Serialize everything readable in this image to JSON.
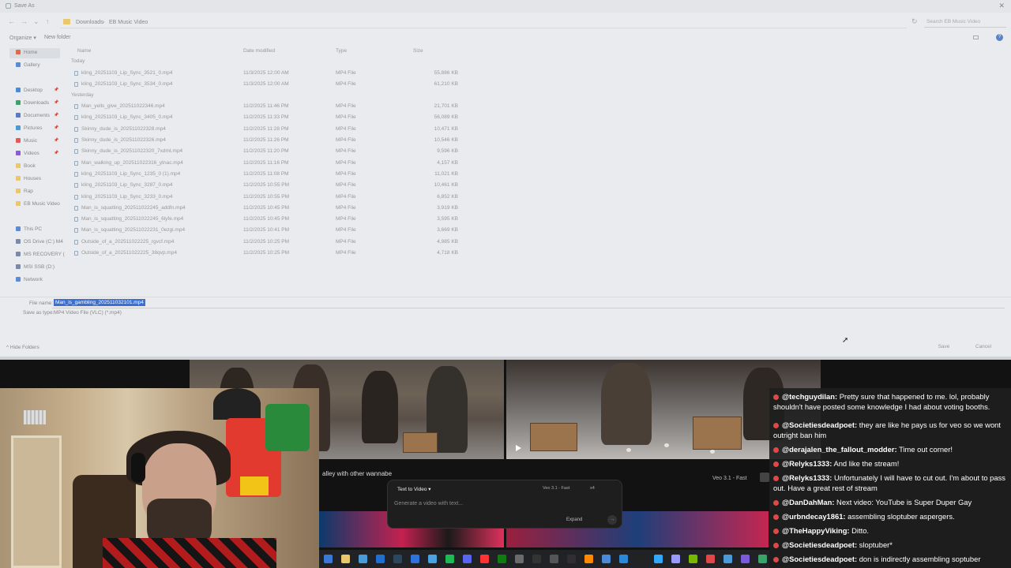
{
  "dialog": {
    "title": "Save As",
    "breadcrumbs": [
      "Downloads",
      "›",
      "EB Music Video"
    ],
    "search_placeholder": "Search EB Music Video",
    "organize_label": "Organize ▾",
    "new_folder_label": "New folder",
    "sidebar": [
      {
        "label": "Home",
        "icon": "home-icon",
        "color": "#e06a4a"
      },
      {
        "label": "Gallery",
        "icon": "gallery-icon",
        "color": "#5a8ad8"
      },
      {
        "label": "Desktop",
        "icon": "desktop-icon",
        "color": "#4a8ad8"
      },
      {
        "label": "Downloads",
        "icon": "downloads-icon",
        "color": "#3aa36a"
      },
      {
        "label": "Documents",
        "icon": "documents-icon",
        "color": "#5a7ac8"
      },
      {
        "label": "Pictures",
        "icon": "pictures-icon",
        "color": "#4a9ad8"
      },
      {
        "label": "Music",
        "icon": "music-icon",
        "color": "#e05a5a"
      },
      {
        "label": "Videos",
        "icon": "videos-icon",
        "color": "#8a5ad8"
      },
      {
        "label": "Book",
        "icon": "folder-icon",
        "color": "#e8c86a"
      },
      {
        "label": "Houses",
        "icon": "folder-icon",
        "color": "#e8c86a"
      },
      {
        "label": "Rap",
        "icon": "folder-icon",
        "color": "#e8c86a"
      },
      {
        "label": "EB Music Video",
        "icon": "folder-icon",
        "color": "#e8c86a"
      },
      {
        "label": "This PC",
        "icon": "pc-icon",
        "color": "#5a8ad8"
      },
      {
        "label": "OS Drive (C:) M4",
        "icon": "drive-icon",
        "color": "#7a8aa8"
      },
      {
        "label": "MS RECOVERY (",
        "icon": "drive-icon",
        "color": "#7a8aa8"
      },
      {
        "label": "MSI SSB (D:)",
        "icon": "drive-icon",
        "color": "#7a8aa8"
      },
      {
        "label": "Network",
        "icon": "network-icon",
        "color": "#5a8ad8"
      }
    ],
    "columns": {
      "name": "Name",
      "date": "Date modified",
      "type": "Type",
      "size": "Size"
    },
    "groups": [
      {
        "label": "Today",
        "files": [
          {
            "name": "kling_20251103_Lip_Sync_3521_0.mp4",
            "date": "11/3/2025 12:00 AM",
            "type": "MP4 File",
            "size": "55,886 KB"
          },
          {
            "name": "kling_20251103_Lip_Sync_3534_0.mp4",
            "date": "11/3/2025 12:00 AM",
            "type": "MP4 File",
            "size": "61,210 KB"
          }
        ]
      },
      {
        "label": "Yesterday",
        "files": [
          {
            "name": "Man_yells_give_202511022346.mp4",
            "date": "11/2/2025 11:46 PM",
            "type": "MP4 File",
            "size": "21,701 KB"
          },
          {
            "name": "kling_20251103_Lip_Sync_3405_0.mp4",
            "date": "11/2/2025 11:33 PM",
            "type": "MP4 File",
            "size": "56,089 KB"
          },
          {
            "name": "Skinny_dude_is_202511022328.mp4",
            "date": "11/2/2025 11:28 PM",
            "type": "MP4 File",
            "size": "10,471 KB"
          },
          {
            "name": "Skinny_dude_is_202511022326.mp4",
            "date": "11/2/2025 11:26 PM",
            "type": "MP4 File",
            "size": "10,546 KB"
          },
          {
            "name": "Skinny_dude_is_202511022320_7xdmt.mp4",
            "date": "11/2/2025 11:20 PM",
            "type": "MP4 File",
            "size": "9,596 KB"
          },
          {
            "name": "Man_walking_up_202511022316_ytnac.mp4",
            "date": "11/2/2025 11:16 PM",
            "type": "MP4 File",
            "size": "4,157 KB"
          },
          {
            "name": "kling_20251103_Lip_Sync_1235_0 (1).mp4",
            "date": "11/2/2025 11:08 PM",
            "type": "MP4 File",
            "size": "11,021 KB"
          },
          {
            "name": "kling_20251103_Lip_Sync_3287_0.mp4",
            "date": "11/2/2025 10:55 PM",
            "type": "MP4 File",
            "size": "10,461 KB"
          },
          {
            "name": "kling_20251103_Lip_Sync_3233_0.mp4",
            "date": "11/2/2025 10:55 PM",
            "type": "MP4 File",
            "size": "6,852 KB"
          },
          {
            "name": "Man_is_squatting_202511022245_addfn.mp4",
            "date": "11/2/2025 10:45 PM",
            "type": "MP4 File",
            "size": "3,919 KB"
          },
          {
            "name": "Man_is_squatting_202511022245_6lyfe.mp4",
            "date": "11/2/2025 10:45 PM",
            "type": "MP4 File",
            "size": "3,595 KB"
          },
          {
            "name": "Man_is_squatting_202511022231_0ezgi.mp4",
            "date": "11/2/2025 10:41 PM",
            "type": "MP4 File",
            "size": "3,669 KB"
          },
          {
            "name": "Outside_of_a_202511022225_rgvcf.mp4",
            "date": "11/2/2025 10:25 PM",
            "type": "MP4 File",
            "size": "4,985 KB"
          },
          {
            "name": "Outside_of_a_202511022225_38qvp.mp4",
            "date": "11/2/2025 10:25 PM",
            "type": "MP4 File",
            "size": "4,718 KB"
          }
        ]
      }
    ],
    "file_name_label": "File name:",
    "file_name_value": "Man_is_gambling_202511032101.mp4",
    "save_type_label": "Save as type:",
    "save_type_value": "MP4 Video File (VLC) (*.mp4)",
    "hide_folders_label": "^ Hide Folders",
    "save_label": "Save",
    "cancel_label": "Cancel"
  },
  "app": {
    "prompt_fragment": "alley with other wannabe",
    "model_tag": "Veo 3.1 - Fast",
    "composer": {
      "mode_label": "Text to Video ▾",
      "model_label": "Veo 3.1 - Fast",
      "options_label": "x4",
      "placeholder": "Generate a video with text...",
      "expand_label": "Expand",
      "send_glyph": "→"
    }
  },
  "taskbar_icons": [
    "edge-icon",
    "folder-icon",
    "chrome-icon",
    "store-icon",
    "steam-icon",
    "mail-icon",
    "photos-icon",
    "spotify-icon",
    "discord-icon",
    "youtube-icon",
    "xbox-icon",
    "settings-icon",
    "terminal-icon",
    "calculator-icon",
    "obs-icon",
    "vlc-icon",
    "notepad-icon",
    "paint-icon",
    "capcut-icon",
    "photoshop-icon",
    "premiere-icon",
    "nvidia-icon",
    "game-icon",
    "app-icon",
    "app2-icon",
    "app3-icon"
  ],
  "chat": [
    {
      "user": "@techguydilan:",
      "text": " Pretty sure that happened to me. lol, probably shouldn't have posted some knowledge I had about voting booths."
    },
    {
      "user": "@Societiesdeadpoet:",
      "text": " they are like he pays us for veo so we wont outright ban him"
    },
    {
      "user": "@derajalen_the_fallout_modder:",
      "text": " Time out corner!"
    },
    {
      "user": "@Relyks1333:",
      "text": " And like the stream!"
    },
    {
      "user": "@Relyks1333:",
      "text": " Unfortunately I will have to cut out. I'm about to pass out. Have a great rest of stream"
    },
    {
      "user": "@DanDahMan:",
      "text": " Next video: YouTube is Super Duper Gay"
    },
    {
      "user": "@urbndecay1861:",
      "text": " assembling sloptuber aspergers."
    },
    {
      "user": "@TheHappyViking:",
      "text": " Ditto."
    },
    {
      "user": "@Societiesdeadpoet:",
      "text": " sloptuber*"
    },
    {
      "user": "@Societiesdeadpoet:",
      "text": " don is indirectly assembling soptuber aspergers"
    }
  ]
}
